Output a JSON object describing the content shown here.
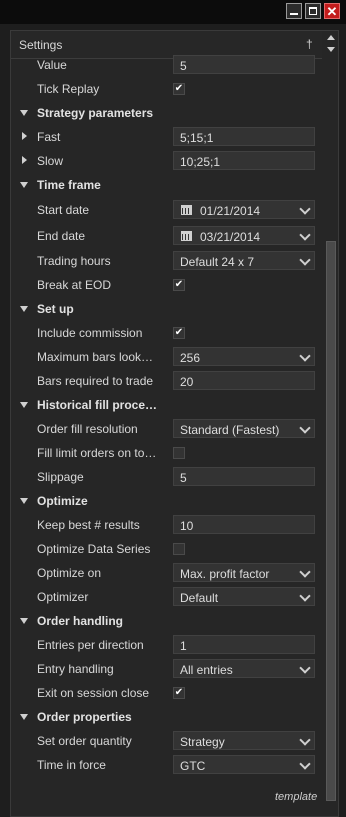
{
  "window": {
    "min_icon": "minimize-icon",
    "max_icon": "maximize-icon",
    "close_glyph": "✕",
    "close_icon": "close-icon",
    "close_color": "#c41c1c"
  },
  "panel": {
    "title": "Settings",
    "pin_glyph": "†",
    "template_link": "template"
  },
  "rows": {
    "value": {
      "label": "Value",
      "value": "5"
    },
    "tick_replay": {
      "label": "Tick Replay",
      "checked": true
    },
    "strategy_parameters": {
      "label": "Strategy parameters"
    },
    "fast": {
      "label": "Fast",
      "value": "5;15;1"
    },
    "slow": {
      "label": "Slow",
      "value": "10;25;1"
    },
    "time_frame": {
      "label": "Time frame"
    },
    "start_date": {
      "label": "Start date",
      "value": "01/21/2014"
    },
    "end_date": {
      "label": "End date",
      "value": "03/21/2014"
    },
    "trading_hours": {
      "label": "Trading hours",
      "value": "Default 24 x 7"
    },
    "break_at_eod": {
      "label": "Break at EOD",
      "checked": true
    },
    "set_up": {
      "label": "Set up"
    },
    "include_commission": {
      "label": "Include commission",
      "checked": true
    },
    "max_bars_lookback": {
      "label": "Maximum bars look…",
      "value": "256"
    },
    "bars_required": {
      "label": "Bars required to trade",
      "value": "20"
    },
    "historical_fill": {
      "label": "Historical fill proce…"
    },
    "order_fill_resolution": {
      "label": "Order fill resolution",
      "value": "Standard (Fastest)"
    },
    "fill_limit_orders": {
      "label": "Fill limit orders on to…",
      "checked": false
    },
    "slippage": {
      "label": "Slippage",
      "value": "5"
    },
    "optimize": {
      "label": "Optimize"
    },
    "keep_best": {
      "label": "Keep best # results",
      "value": "10"
    },
    "optimize_data_series": {
      "label": "Optimize Data Series",
      "checked": false
    },
    "optimize_on": {
      "label": "Optimize on",
      "value": "Max. profit factor"
    },
    "optimizer": {
      "label": "Optimizer",
      "value": "Default"
    },
    "order_handling": {
      "label": "Order handling"
    },
    "entries_per_direction": {
      "label": "Entries per direction",
      "value": "1"
    },
    "entry_handling": {
      "label": "Entry handling",
      "value": "All entries"
    },
    "exit_on_session_close": {
      "label": "Exit on session close",
      "checked": true
    },
    "order_properties": {
      "label": "Order properties"
    },
    "set_order_quantity": {
      "label": "Set order quantity",
      "value": "Strategy"
    },
    "time_in_force": {
      "label": "Time in force",
      "value": "GTC"
    }
  },
  "check_glyph": "✔"
}
